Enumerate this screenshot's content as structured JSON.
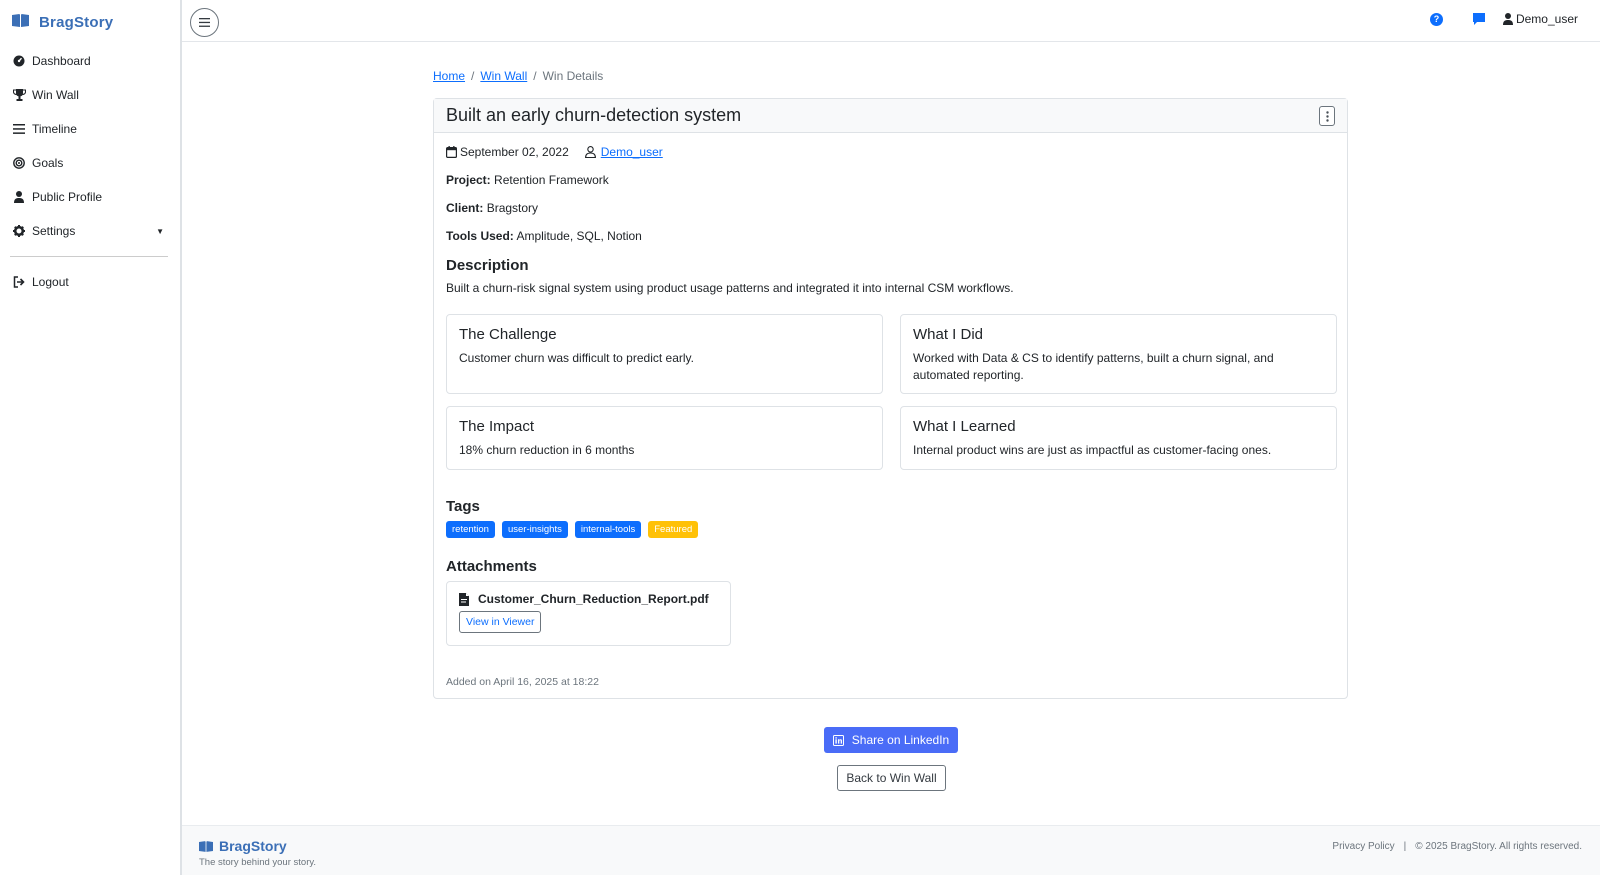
{
  "brand": {
    "name": "BragStory",
    "tagline": "The story behind your story."
  },
  "sidebar": {
    "items": [
      {
        "label": "Dashboard",
        "icon": "dashboard-icon"
      },
      {
        "label": "Win Wall",
        "icon": "trophy-icon"
      },
      {
        "label": "Timeline",
        "icon": "list-icon"
      },
      {
        "label": "Goals",
        "icon": "target-icon"
      },
      {
        "label": "Public Profile",
        "icon": "user-icon"
      },
      {
        "label": "Settings",
        "icon": "gear-icon"
      }
    ],
    "logout": "Logout"
  },
  "topbar": {
    "user": "Demo_user",
    "help_icon": "question-circle-icon",
    "chat_icon": "chat-icon"
  },
  "breadcrumb": {
    "home": "Home",
    "win_wall": "Win Wall",
    "current": "Win Details",
    "separator": "/"
  },
  "win": {
    "title": "Built an early churn-detection system",
    "date": "September 02, 2022",
    "author": "Demo_user",
    "project_label": "Project:",
    "project": "Retention Framework",
    "client_label": "Client:",
    "client": "Bragstory",
    "tools_label": "Tools Used:",
    "tools": "Amplitude, SQL, Notion",
    "description_heading": "Description",
    "description": "Built a churn-risk signal system using product usage patterns and integrated it into internal CSM workflows.",
    "challenge": {
      "heading": "The Challenge",
      "text": "Customer churn was difficult to predict early."
    },
    "did": {
      "heading": "What I Did",
      "text": "Worked with Data & CS to identify patterns, built a churn signal, and automated reporting."
    },
    "impact": {
      "heading": "The Impact",
      "text": "18% churn reduction in 6 months"
    },
    "learned": {
      "heading": "What I Learned",
      "text": "Internal product wins are just as impactful as customer-facing ones."
    },
    "tags_heading": "Tags",
    "tags": [
      "retention",
      "user-insights",
      "internal-tools",
      "Featured"
    ],
    "attachments_heading": "Attachments",
    "attachment": {
      "name": "Customer_Churn_Reduction_Report.pdf",
      "button": "View in Viewer"
    },
    "added": "Added on April 16, 2025 at 18:22"
  },
  "actions": {
    "share": "Share on LinkedIn",
    "back": "Back to Win Wall"
  },
  "footer": {
    "privacy": "Privacy Policy",
    "separator": "|",
    "copyright": "© 2025 BragStory. All rights reserved."
  },
  "colors": {
    "brand": "#3b6fb6",
    "primary": "#0d6efd",
    "linkedin": "#4a6cf7",
    "featured": "#ffc107"
  }
}
